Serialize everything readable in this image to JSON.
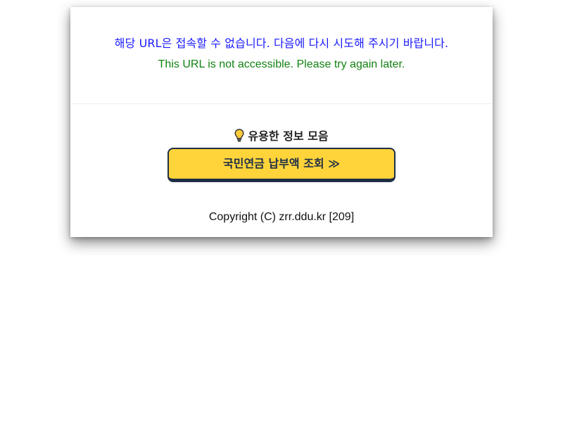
{
  "message": {
    "korean": "해당 URL은 접속할 수 없습니다. 다음에 다시 시도해 주시기 바랍니다.",
    "english": "This URL is not accessible. Please try again later.",
    "korean_color": "#1a1aff",
    "english_color": "#128212"
  },
  "info": {
    "icon": "lightbulb-icon",
    "title": "유용한 정보 모음"
  },
  "button": {
    "label": "국민연금 납부액 조회 ≫",
    "background": "#ffd43a",
    "border_color": "#1f2e46"
  },
  "footer": {
    "copyright": "Copyright (C) zrr.ddu.kr [209]"
  }
}
